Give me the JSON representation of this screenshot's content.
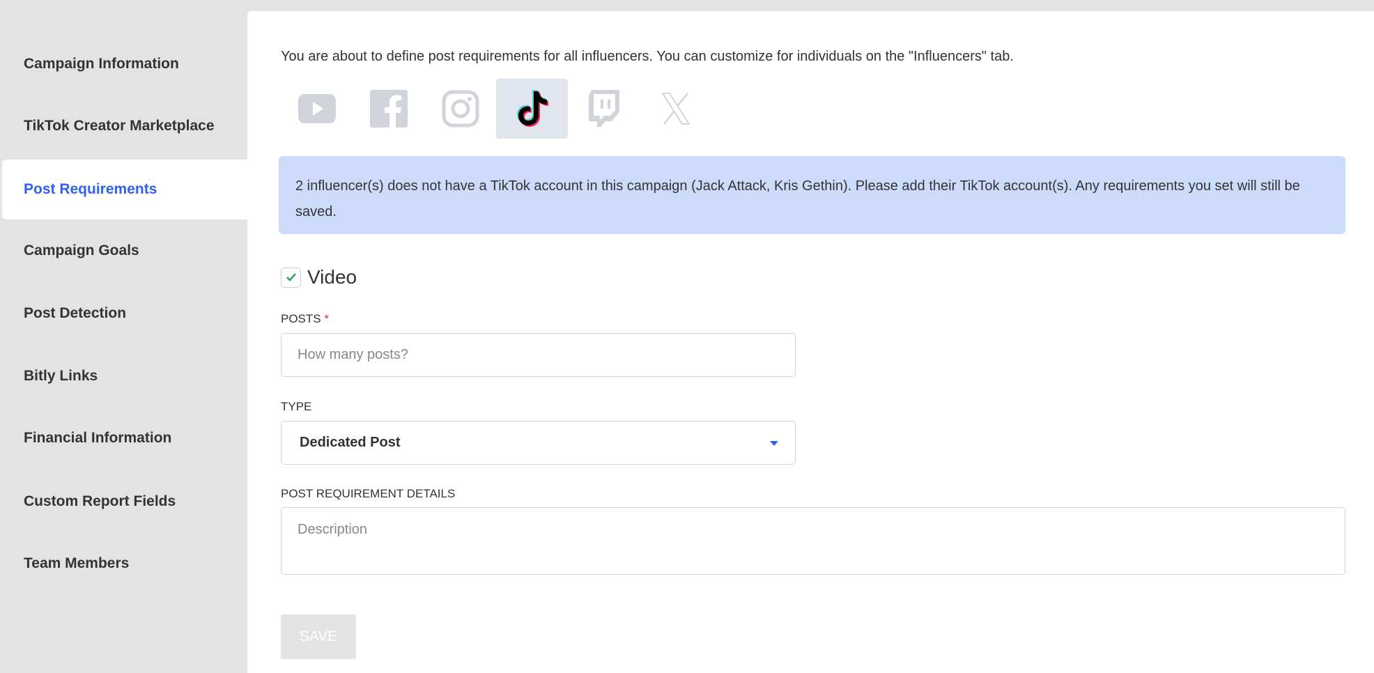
{
  "sidebar": {
    "items": [
      {
        "label": "Campaign Information"
      },
      {
        "label": "TikTok Creator Marketplace"
      },
      {
        "label": "Post Requirements",
        "active": true
      },
      {
        "label": "Campaign Goals"
      },
      {
        "label": "Post Detection"
      },
      {
        "label": "Bitly Links"
      },
      {
        "label": "Financial Information"
      },
      {
        "label": "Custom Report Fields"
      },
      {
        "label": "Team Members"
      }
    ]
  },
  "main": {
    "intro": "You are about to define post requirements for all influencers. You can customize for individuals on the \"Influencers\" tab.",
    "platforms": [
      {
        "icon": "youtube-icon"
      },
      {
        "icon": "facebook-icon"
      },
      {
        "icon": "instagram-icon"
      },
      {
        "icon": "tiktok-icon",
        "selected": true
      },
      {
        "icon": "twitch-icon"
      },
      {
        "icon": "x-icon"
      }
    ],
    "alert": "2 influencer(s) does not have a TikTok account in this campaign (Jack Attack, Kris Gethin). Please add their TikTok account(s). Any requirements you set will still be saved.",
    "video": {
      "label": "Video",
      "checked": true
    },
    "posts": {
      "label": "POSTS",
      "required_mark": "*",
      "placeholder": "How many posts?",
      "value": ""
    },
    "type": {
      "label": "TYPE",
      "value": "Dedicated Post"
    },
    "details": {
      "label": "POST REQUIREMENT DETAILS",
      "placeholder": "Description",
      "value": ""
    },
    "save_label": "SAVE"
  },
  "colors": {
    "accent": "#2d63f0",
    "alert_bg": "#cddbfb",
    "check": "#22a34a",
    "icon_inactive": "#d1d5db"
  }
}
